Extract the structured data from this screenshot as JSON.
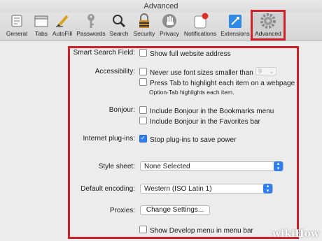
{
  "window": {
    "title": "Advanced"
  },
  "toolbar": [
    {
      "label": "General",
      "icon": "general-icon"
    },
    {
      "label": "Tabs",
      "icon": "tabs-icon"
    },
    {
      "label": "AutoFill",
      "icon": "autofill-pencil-icon"
    },
    {
      "label": "Passwords",
      "icon": "key-icon"
    },
    {
      "label": "Search",
      "icon": "search-icon"
    },
    {
      "label": "Security",
      "icon": "lock-icon"
    },
    {
      "label": "Privacy",
      "icon": "hand-icon"
    },
    {
      "label": "Notifications",
      "icon": "notifications-icon"
    },
    {
      "label": "Extensions",
      "icon": "extensions-icon"
    },
    {
      "label": "Advanced",
      "icon": "gear-icon",
      "selected": true
    }
  ],
  "settings": {
    "smart_search": {
      "label": "Smart Search Field:",
      "option": "Show full website address",
      "checked": false
    },
    "accessibility": {
      "label": "Accessibility:",
      "font_option": "Never use font sizes smaller than",
      "font_size": "9",
      "tab_option": "Press Tab to highlight each item on a webpage",
      "tab_note": "Option-Tab highlights each item."
    },
    "bonjour": {
      "label": "Bonjour:",
      "bookmarks_option": "Include Bonjour in the Bookmarks menu",
      "favorites_option": "Include Bonjour in the Favorites bar"
    },
    "plugins": {
      "label": "Internet plug-ins:",
      "option": "Stop plug-ins to save power",
      "checked": true
    },
    "style_sheet": {
      "label": "Style sheet:",
      "value": "None Selected"
    },
    "encoding": {
      "label": "Default encoding:",
      "value": "Western (ISO Latin 1)"
    },
    "proxies": {
      "label": "Proxies:",
      "button": "Change Settings..."
    },
    "develop": {
      "option": "Show Develop menu in menu bar",
      "checked": false
    }
  },
  "watermark": "wikiHow",
  "colors": {
    "highlight": "#d0202a",
    "accent": "#2f7ef0"
  }
}
